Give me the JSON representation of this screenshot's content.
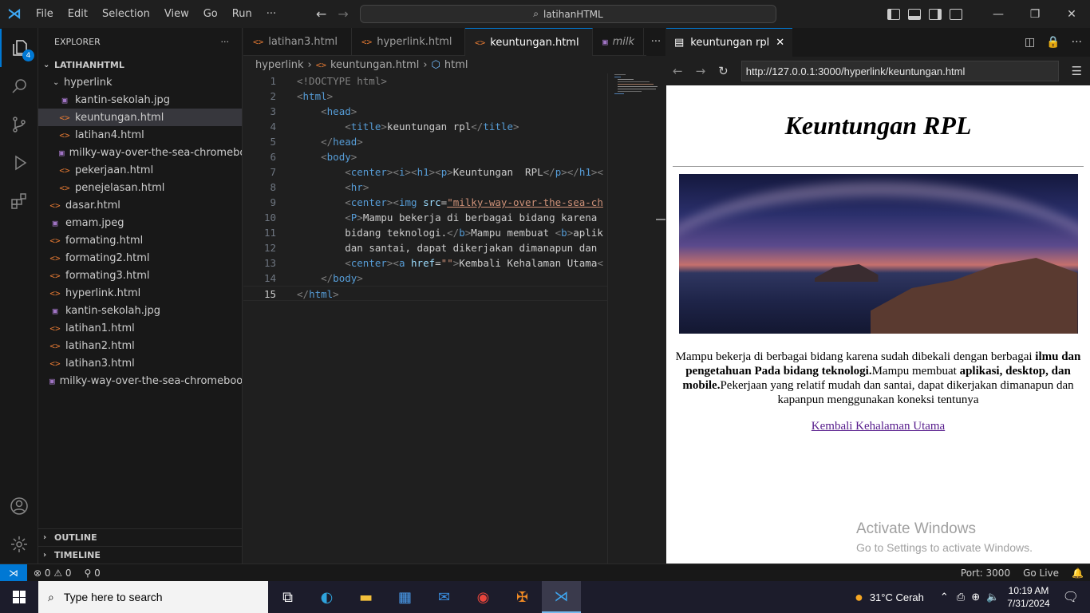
{
  "titlebar": {
    "menu": [
      "File",
      "Edit",
      "Selection",
      "View",
      "Go",
      "Run",
      "···"
    ],
    "search": "latihanHTML",
    "controls": {
      "minimize": "—",
      "restore": "❐",
      "close": "✕"
    }
  },
  "activity": {
    "explorer_badge": "4"
  },
  "sidebar": {
    "header": "EXPLORER",
    "more": "···",
    "root": "LATIHANHTML",
    "folder": "hyperlink",
    "folder_items": [
      {
        "name": "kantin-sekolah.jpg",
        "type": "img"
      },
      {
        "name": "keuntungan.html",
        "type": "html",
        "selected": true
      },
      {
        "name": "latihan4.html",
        "type": "html"
      },
      {
        "name": "milky-way-over-the-sea-chromebo...",
        "type": "img"
      },
      {
        "name": "pekerjaan.html",
        "type": "html"
      },
      {
        "name": "penejelasan.html",
        "type": "html"
      }
    ],
    "root_items": [
      {
        "name": "dasar.html",
        "type": "html"
      },
      {
        "name": "emam.jpeg",
        "type": "img"
      },
      {
        "name": "formating.html",
        "type": "html"
      },
      {
        "name": "formating2.html",
        "type": "html"
      },
      {
        "name": "formating3.html",
        "type": "html"
      },
      {
        "name": "hyperlink.html",
        "type": "html"
      },
      {
        "name": "kantin-sekolah.jpg",
        "type": "img"
      },
      {
        "name": "latihan1.html",
        "type": "html"
      },
      {
        "name": "latihan2.html",
        "type": "html"
      },
      {
        "name": "latihan3.html",
        "type": "html"
      },
      {
        "name": "milky-way-over-the-sea-chromeboo...",
        "type": "img"
      }
    ],
    "outline": "OUTLINE",
    "timeline": "TIMELINE"
  },
  "editor": {
    "tabs": [
      {
        "label": "latihan3.html",
        "dirty": false
      },
      {
        "label": "hyperlink.html",
        "dirty": true
      },
      {
        "label": "keuntungan.html",
        "dirty": true,
        "active": true
      },
      {
        "label": "milk",
        "dirty": false
      }
    ],
    "breadcrumb": [
      "hyperlink",
      "keuntungan.html",
      "html"
    ],
    "line_numbers": [
      "1",
      "2",
      "3",
      "4",
      "5",
      "6",
      "7",
      "8",
      "9",
      "10",
      "11",
      "12",
      "13",
      "14",
      "15"
    ],
    "code": {
      "l1": "<!DOCTYPE html>",
      "l7_text": "Keuntungan  RPL",
      "l9_src": "\"milky-way-over-the-sea-ch",
      "l10_text": "Mampu bekerja di berbagai bidang karena",
      "l11_text": "bidang teknologi.",
      "l11_b": "Mampu membuat ",
      "l11_tail": "aplik",
      "l12_text": "dan santai, dapat dikerjakan dimanapun dan",
      "l13_href": "\"\"",
      "l13_text": "Kembali Kehalaman Utama"
    }
  },
  "browser": {
    "tab_title": "keuntungan rpl",
    "url": "http://127.0.0.1:3000/hyperlink/keuntungan.html",
    "page": {
      "heading": "Keuntungan RPL",
      "para_1": "Mampu bekerja di berbagai bidang karena sudah dibekali dengan berbagai ",
      "para_b1": "ilmu dan pengetahuan Pada bidang teknologi.",
      "para_2": "Mampu membuat ",
      "para_b2": "aplikasi, desktop, dan mobile.",
      "para_3": "Pekerjaan yang relatif mudah dan santai, dapat dikerjakan dimanapun dan kapanpun menggunakan koneksi tentunya",
      "link": "Kembali Kehalaman Utama"
    },
    "watermark": {
      "title": "Activate Windows",
      "subtitle": "Go to Settings to activate Windows."
    }
  },
  "statusbar": {
    "errors": "⊗ 0 ⚠ 0",
    "ports": "⚲ 0",
    "port": "Port: 3000",
    "golive": "Go Live"
  },
  "taskbar": {
    "search_placeholder": "Type here to search",
    "weather": "31°C  Cerah",
    "time": "10:19 AM",
    "date": "7/31/2024"
  }
}
